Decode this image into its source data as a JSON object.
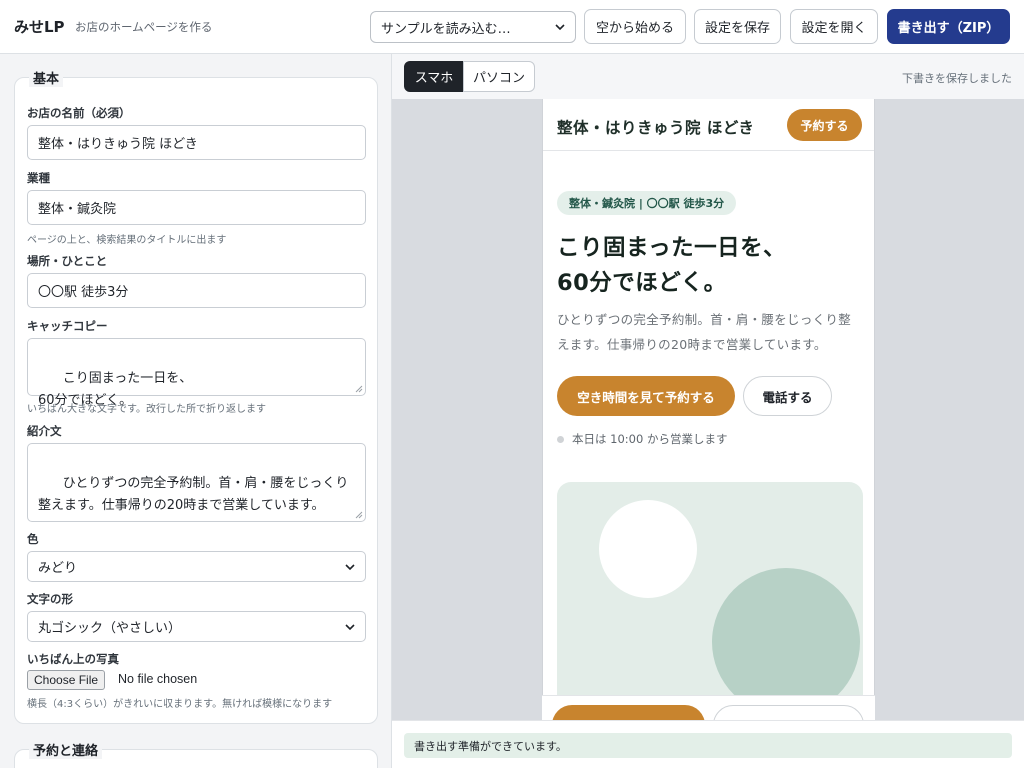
{
  "header": {
    "brand": "みせLP",
    "tagline": "お店のホームページを作る",
    "sample_select": "サンプルを読み込む…",
    "buttons": {
      "start_blank": "空から始める",
      "save_settings": "設定を保存",
      "open_settings": "設定を開く",
      "export_zip": "書き出す（ZIP）"
    }
  },
  "form": {
    "basic_legend": "基本",
    "shop_name_label": "お店の名前（必須）",
    "shop_name_value": "整体・はりきゅう院 ほどき",
    "industry_label": "業種",
    "industry_value": "整体・鍼灸院",
    "industry_hint": "ページの上と、検索結果のタイトルに出ます",
    "location_label": "場所・ひとこと",
    "location_value": "〇〇駅 徒歩3分",
    "catch_label": "キャッチコピー",
    "catch_value": "こり固まった一日を、\n60分でほどく。",
    "catch_hint": "いちばん大きな文字です。改行した所で折り返します",
    "intro_label": "紹介文",
    "intro_value": "ひとりずつの完全予約制。首・肩・腰をじっくり整えます。仕事帰りの20時まで営業しています。",
    "color_label": "色",
    "color_value": "みどり",
    "font_label": "文字の形",
    "font_value": "丸ゴシック（やさしい）",
    "photo_label": "いちばん上の写真",
    "file_button": "Choose File",
    "file_status": "No file chosen",
    "photo_hint": "横長（4:3くらい）がきれいに収まります。無ければ模様になります",
    "contact_legend": "予約と連絡"
  },
  "preview": {
    "device_tabs": {
      "mobile": "スマホ",
      "desktop": "パソコン"
    },
    "save_status": "下書きを保存しました",
    "site": {
      "title": "整体・はりきゅう院 ほどき",
      "reserve": "予約する",
      "badge": "整体・鍼灸院 | 〇〇駅 徒歩3分",
      "headline": "こり固まった一日を、\n60分でほどく。",
      "description": "ひとりずつの完全予約制。首・肩・腰をじっくり整えます。仕事帰りの20時まで営業しています。",
      "cta_primary": "空き時間を見て予約する",
      "cta_call": "電話する",
      "hours": "本日は 10:00 から営業します"
    },
    "status_message": "書き出す準備ができています。"
  },
  "colors": {
    "accent": "#c8842e",
    "export_button": "#243b8e",
    "hero_bg": "#e3ede8",
    "hero_circle": "#b7d1c6",
    "status_bg": "#e3efe8"
  }
}
